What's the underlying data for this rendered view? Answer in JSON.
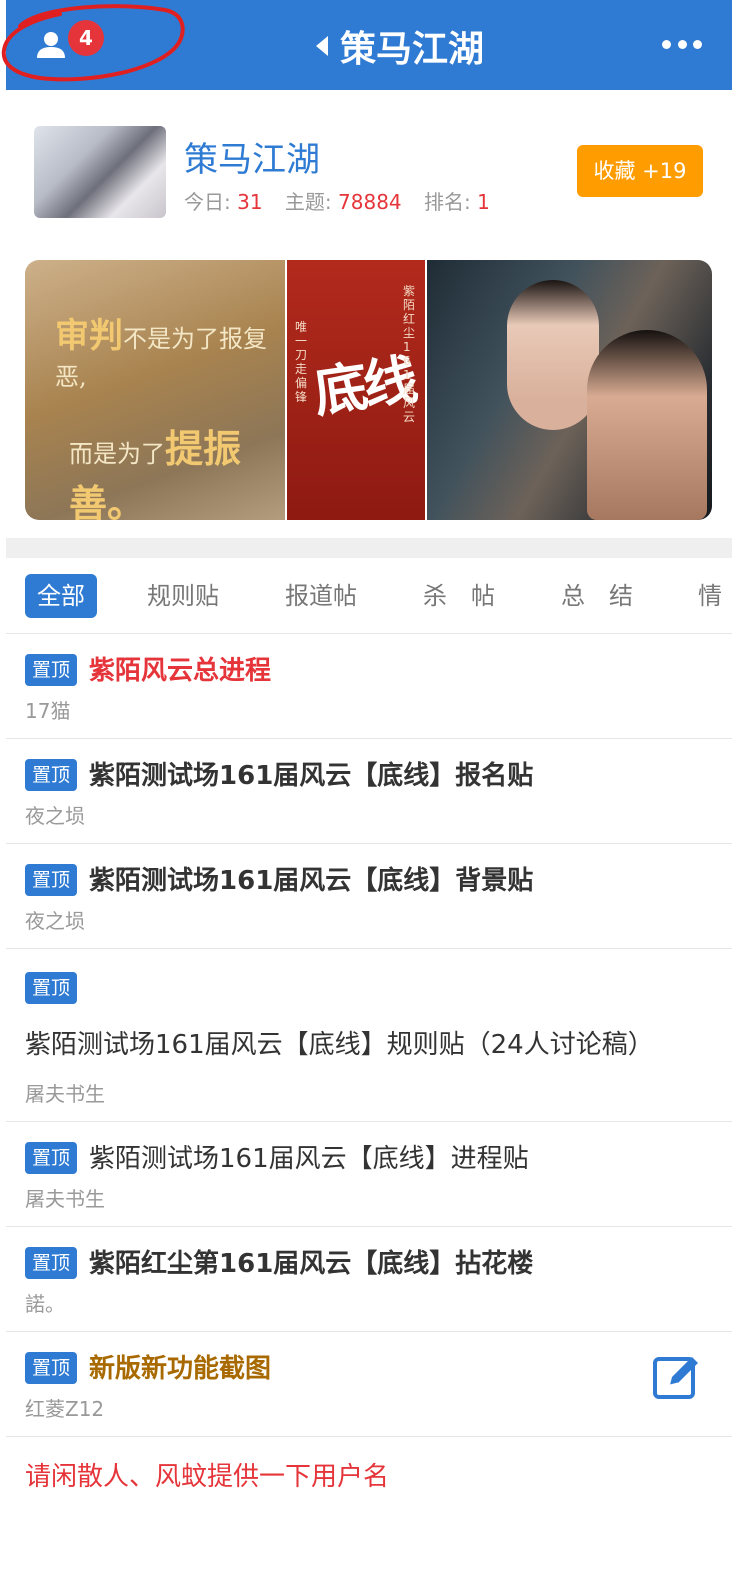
{
  "navbar": {
    "title": "策马江湖",
    "badge_count": "4",
    "user_icon": "user-icon",
    "more_icon": "more-dots-icon",
    "annotation_color": "#e02020"
  },
  "forum": {
    "name": "策马江湖",
    "today_label": "今日:",
    "today_value": "31",
    "topics_label": "主题:",
    "topics_value": "78884",
    "rank_label": "排名:",
    "rank_value": "1",
    "favorite_button": "收藏 +19"
  },
  "banner": {
    "left_line1_big": "审判",
    "left_line1_rest": "不是为了报复恶,",
    "left_line2_rest": "而是为了",
    "left_line2_big": "提振善。",
    "mid_title": "底线",
    "mid_vertical_left": "唯一刀走偏锋",
    "mid_vertical_right": "紫陌红尘161届风云"
  },
  "tabs": [
    {
      "label": "全部",
      "active": true
    },
    {
      "label": "规则贴",
      "active": false
    },
    {
      "label": "报道帖",
      "active": false
    },
    {
      "label": "杀　帖",
      "active": false
    },
    {
      "label": "总　结",
      "active": false
    },
    {
      "label": "情",
      "active": false
    }
  ],
  "threads": [
    {
      "tag": "置顶",
      "title": "紫陌风云总进程",
      "style": "red",
      "author": "17猫"
    },
    {
      "tag": "置顶",
      "title": "紫陌测试场161届风云【底线】报名贴",
      "style": "bold",
      "author": "夜之埙"
    },
    {
      "tag": "置顶",
      "title": "紫陌测试场161届风云【底线】背景贴",
      "style": "bold",
      "author": "夜之埙"
    },
    {
      "tag": "置顶",
      "title": "紫陌测试场161届风云【底线】规则贴（24人讨论稿）",
      "style": "normal",
      "author": "屠夫书生"
    },
    {
      "tag": "置顶",
      "title": "紫陌测试场161届风云【底线】进程贴",
      "style": "normal",
      "author": "屠夫书生"
    },
    {
      "tag": "置顶",
      "title": "紫陌红尘第161届风云【底线】拈花楼",
      "style": "bold",
      "author": "諾。"
    },
    {
      "tag": "置顶",
      "title": "新版新功能截图",
      "style": "brown",
      "author": "红菱Z12"
    }
  ],
  "notice": "请闲散人、风蚊提供一下用户名",
  "colors": {
    "primary": "#2f7bd3",
    "accent_red": "#e5353a",
    "favorite_orange": "#ff9c00",
    "brown_title": "#a86a00"
  },
  "edit_icon": "edit-icon"
}
